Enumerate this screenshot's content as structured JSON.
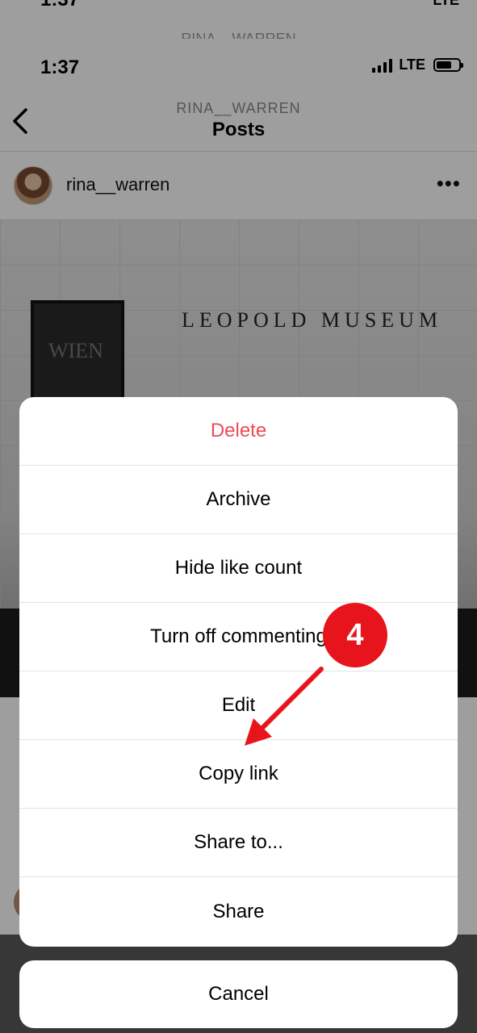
{
  "ghost_top": {
    "time": "1:37",
    "signal_text": "LTE",
    "name": "RINA__WARREN"
  },
  "status_bar": {
    "time": "1:37",
    "network": "LTE"
  },
  "navbar": {
    "subtitle": "RINA__WARREN",
    "title": "Posts"
  },
  "post": {
    "username": "rina__warren",
    "photo_text": "LEOPOLD MUSEUM",
    "sign_text": "WIEN"
  },
  "action_sheet": {
    "items": [
      {
        "label": "Delete",
        "style": "destructive"
      },
      {
        "label": "Archive"
      },
      {
        "label": "Hide like count"
      },
      {
        "label": "Turn off commenting"
      },
      {
        "label": "Edit"
      },
      {
        "label": "Copy link"
      },
      {
        "label": "Share to..."
      },
      {
        "label": "Share"
      }
    ],
    "cancel_label": "Cancel"
  },
  "annotation": {
    "step_number": "4",
    "color": "#e8141c"
  },
  "colors": {
    "destructive": "#ed4956",
    "accent_annotation": "#e8141c"
  },
  "icons": [
    "back-chevron-icon",
    "more-options-icon",
    "signal-icon",
    "battery-icon"
  ]
}
